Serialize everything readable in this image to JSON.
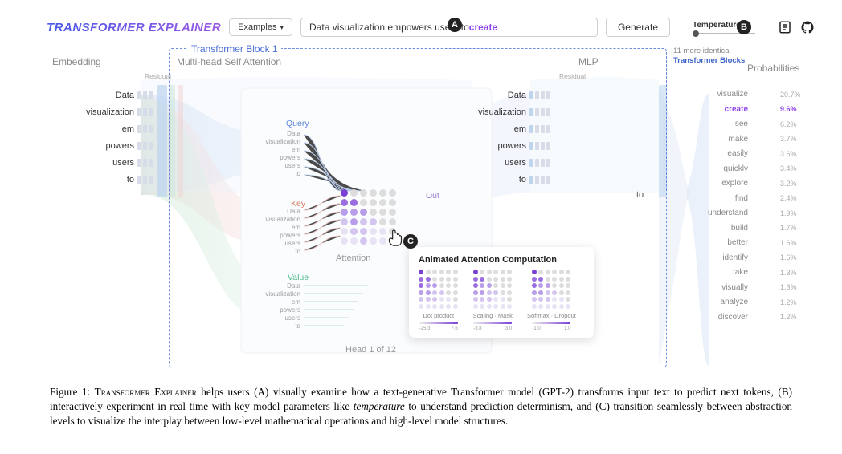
{
  "topbar": {
    "logo": "Transformer Explainer",
    "examples": "Examples",
    "input_prefix": "Data visualization empowers users to ",
    "input_highlight": "create",
    "generate": "Generate",
    "temperature": "Temperature"
  },
  "markers": {
    "a": "A",
    "b": "B",
    "c": "C"
  },
  "sections": {
    "embedding": "Embedding",
    "block": "Transformer Block 1",
    "attention": "Multi-head Self Attention",
    "mlp": "MLP",
    "residual": "Residual",
    "probabilities": "Probabilities",
    "more_count": "11 more identical",
    "more_link": "Transformer Blocks",
    "attention_label": "Attention",
    "out_label": "Out",
    "head": "Head 1 of 12",
    "to": "to"
  },
  "qkv": {
    "query": "Query",
    "key": "Key",
    "value": "Value"
  },
  "tokens": [
    "Data",
    "visualization",
    "em",
    "powers",
    "users",
    "to"
  ],
  "mini_tokens": [
    "Data",
    "visualization",
    "em",
    "powers",
    "users",
    "to"
  ],
  "popup": {
    "title": "Animated Attention Computation",
    "steps": [
      {
        "label": "Dot product",
        "lo": "-25.3",
        "hi": "7.6"
      },
      {
        "label": "Scaling · Mask",
        "lo": "-3.8",
        "hi": "3.0"
      },
      {
        "label": "Softmax · Dropout",
        "lo": "-1.0",
        "hi": "1.0"
      }
    ]
  },
  "probabilities": [
    {
      "word": "visualize",
      "pct": "20.7%",
      "w": 28,
      "hl": false
    },
    {
      "word": "create",
      "pct": "9.6%",
      "w": 14,
      "hl": true
    },
    {
      "word": "see",
      "pct": "6.2%",
      "w": 9,
      "hl": false
    },
    {
      "word": "make",
      "pct": "3.7%",
      "w": 6,
      "hl": false
    },
    {
      "word": "easily",
      "pct": "3.6%",
      "w": 6,
      "hl": false
    },
    {
      "word": "quickly",
      "pct": "3.4%",
      "w": 5,
      "hl": false
    },
    {
      "word": "explore",
      "pct": "3.2%",
      "w": 5,
      "hl": false
    },
    {
      "word": "find",
      "pct": "2.4%",
      "w": 4,
      "hl": false
    },
    {
      "word": "understand",
      "pct": "1.9%",
      "w": 3,
      "hl": false
    },
    {
      "word": "build",
      "pct": "1.7%",
      "w": 3,
      "hl": false
    },
    {
      "word": "better",
      "pct": "1.6%",
      "w": 3,
      "hl": false
    },
    {
      "word": "identify",
      "pct": "1.6%",
      "w": 3,
      "hl": false
    },
    {
      "word": "take",
      "pct": "1.3%",
      "w": 3,
      "hl": false
    },
    {
      "word": "visually",
      "pct": "1.3%",
      "w": 3,
      "hl": false
    },
    {
      "word": "analyze",
      "pct": "1.2%",
      "w": 2,
      "hl": false
    },
    {
      "word": "discover",
      "pct": "1.2%",
      "w": 2,
      "hl": false
    }
  ],
  "caption": {
    "fig": "Figure 1: ",
    "name": "Transformer Explainer",
    "body": " helps users (A) visually examine how a text-generative Transformer model (GPT-2) transforms input text to predict next tokens, (B) interactively experiment in real time with key model parameters like ",
    "temp": "temperature",
    "body2": " to understand prediction determinism, and (C) transition seamlessly between abstraction levels to visualize the interplay between low-level mathematical operations and high-level model structures."
  }
}
